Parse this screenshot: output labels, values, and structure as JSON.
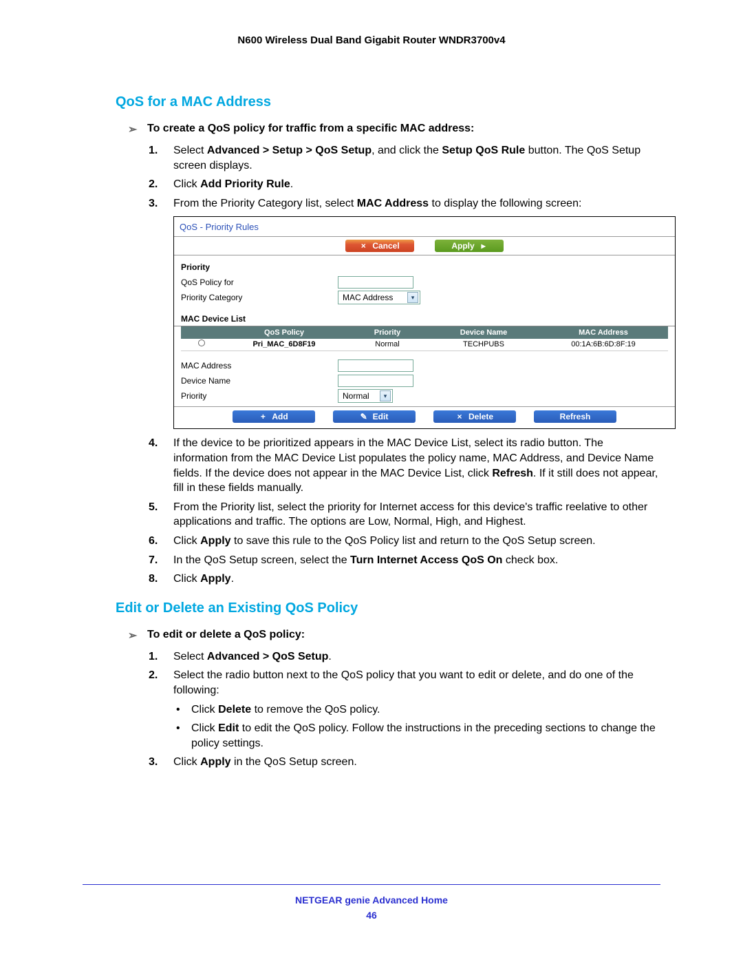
{
  "header": {
    "product": "N600 Wireless Dual Band Gigabit Router WNDR3700v4"
  },
  "sectionA": {
    "heading": "QoS for a MAC Address",
    "intro_arrow": "➢",
    "intro": "To create a QoS policy for traffic from a specific MAC address:",
    "steps": {
      "s1a": "Select ",
      "s1b": "Advanced > Setup > QoS Setup",
      "s1c": ", and click the ",
      "s1d": "Setup QoS Rule",
      "s1e": " button. The QoS Setup screen displays.",
      "s2a": "Click ",
      "s2b": "Add Priority Rule",
      "s2c": ".",
      "s3a": "From the Priority Category list, select ",
      "s3b": "MAC Address",
      "s3c": " to display the following screen:",
      "s4a": "If the device to be prioritized appears in the MAC Device List, select its radio button. The information from the MAC Device List populates the policy name, MAC Address, and Device Name fields. If the device does not appear in the MAC Device List, click ",
      "s4b": "Refresh",
      "s4c": ". If it still does not appear, fill in these fields manually.",
      "s5": "From the Priority list, select the priority for Internet access for this device's traffic reelative to other applications and traffic. The options are Low, Normal, High, and Highest.",
      "s6a": "Click ",
      "s6b": "Apply",
      "s6c": " to save this rule to the QoS Policy list and return to the QoS Setup screen.",
      "s7a": "In the QoS Setup screen, select the ",
      "s7b": "Turn Internet Access QoS On",
      "s7c": " check box.",
      "s8a": "Click ",
      "s8b": "Apply",
      "s8c": "."
    }
  },
  "ui": {
    "title": "QoS - Priority Rules",
    "btn_cancel": "Cancel",
    "btn_apply": "Apply",
    "lbl_priority_hdr": "Priority",
    "lbl_policy_for": "QoS Policy for",
    "lbl_category": "Priority Category",
    "sel_category": "MAC Address",
    "lbl_devlist": "MAC Device List",
    "th": {
      "policy": "QoS Policy",
      "priority": "Priority",
      "devname": "Device Name",
      "mac": "MAC Address"
    },
    "row": {
      "policy": "Pri_MAC_6D8F19",
      "priority": "Normal",
      "devname": "TECHPUBS",
      "mac": "00:1A:6B:6D:8F:19"
    },
    "lbl_mac": "MAC Address",
    "lbl_devname": "Device Name",
    "lbl_priority": "Priority",
    "sel_priority": "Normal",
    "btn_add": "Add",
    "btn_edit": "Edit",
    "btn_delete": "Delete",
    "btn_refresh": "Refresh"
  },
  "sectionB": {
    "heading": "Edit or Delete an Existing QoS Policy",
    "intro_arrow": "➢",
    "intro": "To edit or delete a QoS policy:",
    "s1a": "Select ",
    "s1b": "Advanced > QoS Setup",
    "s1c": ".",
    "s2": "Select the radio button next to the QoS policy that you want to edit or delete, and do one of the following:",
    "b1a": "Click ",
    "b1b": "Delete",
    "b1c": " to remove the QoS policy.",
    "b2a": "Click ",
    "b2b": "Edit",
    "b2c": " to edit the QoS policy. Follow the instructions in the preceding sections to change the policy settings.",
    "s3a": "Click ",
    "s3b": "Apply",
    "s3c": " in the QoS Setup screen."
  },
  "footer": {
    "text": "NETGEAR genie Advanced Home",
    "page": "46"
  }
}
